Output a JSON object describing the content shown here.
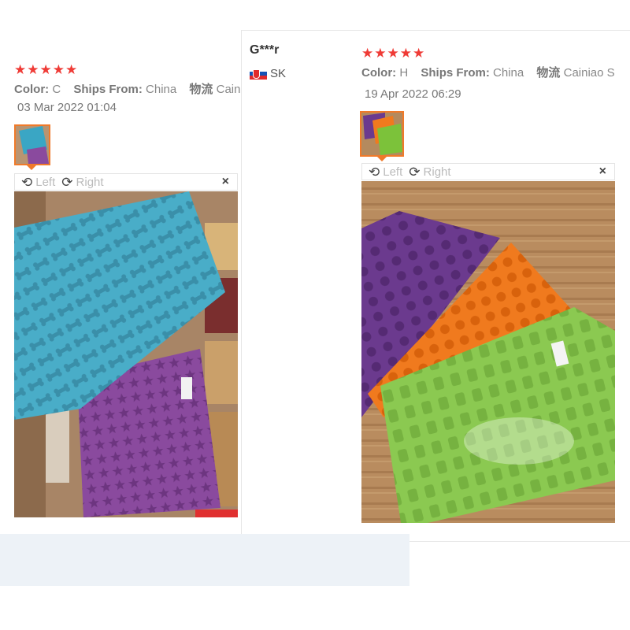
{
  "reviews": [
    {
      "stars": "★★★★★",
      "rating": 5,
      "attributes": [
        {
          "key": "Color:",
          "value": "C"
        },
        {
          "key": "Ships From:",
          "value": "China"
        },
        {
          "key": "物流",
          "value": "Cainiao"
        }
      ],
      "date": "03 Mar 2022 01:04",
      "viewer": {
        "left_label": "Left",
        "right_label": "Right",
        "close_label": "×"
      }
    },
    {
      "user": "G***r",
      "country": "SK",
      "stars": "★★★★★",
      "rating": 5,
      "attributes": [
        {
          "key": "Color:",
          "value": "H"
        },
        {
          "key": "Ships From:",
          "value": "China"
        },
        {
          "key": "物流",
          "value": "Cainiao S"
        }
      ],
      "date": "19 Apr 2022 06:29",
      "viewer": {
        "left_label": "Left",
        "right_label": "Right",
        "close_label": "×"
      }
    }
  ],
  "icons": {
    "rotate_left": "rotate-left-icon",
    "rotate_right": "rotate-right-icon",
    "close": "close-icon",
    "flag": "slovakia-flag-icon"
  },
  "colors": {
    "star": "#ef3b36",
    "thumb_border": "#f07a2a",
    "mold_blue": "#3aa6c4",
    "mold_purple": "#8a4a9e",
    "mold_orange": "#f07a1e",
    "mold_green": "#7cc23a"
  }
}
